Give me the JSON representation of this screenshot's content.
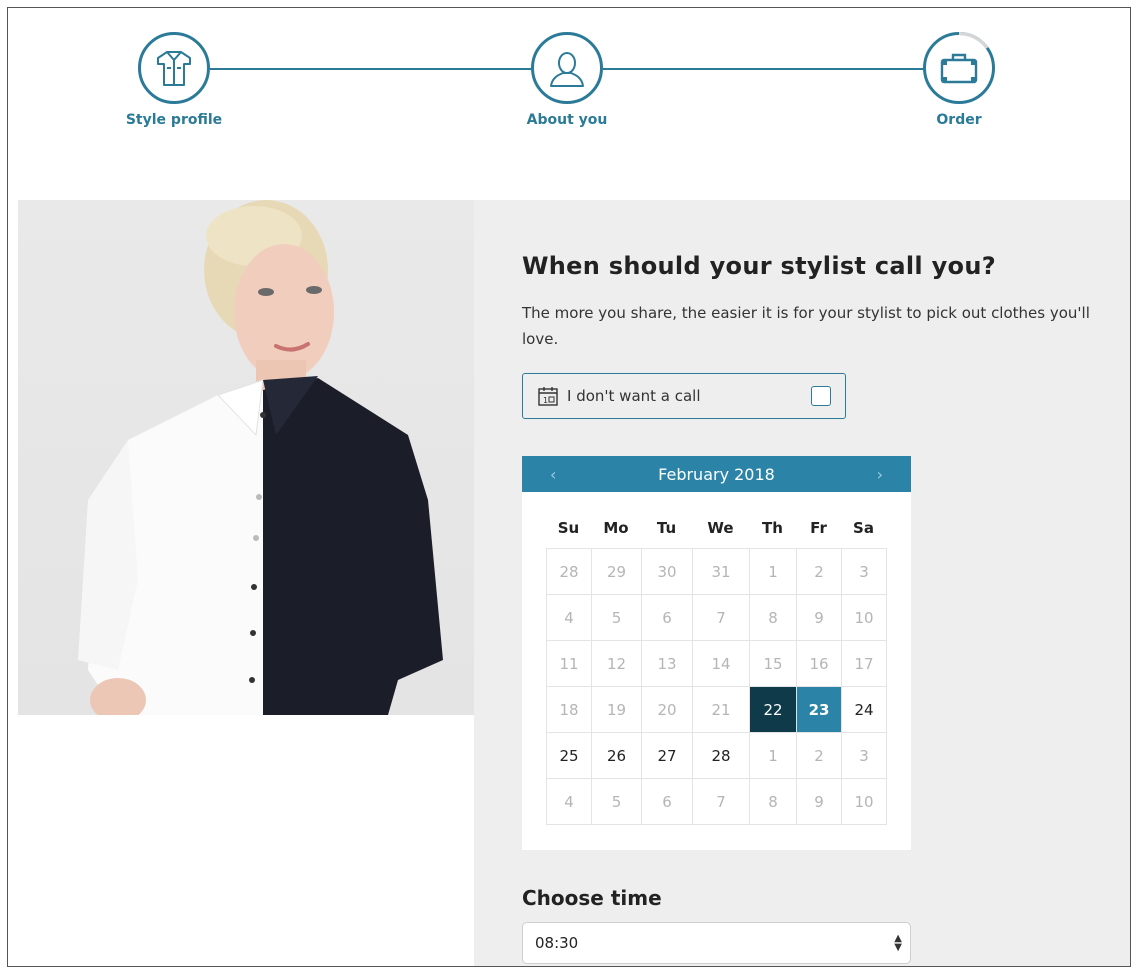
{
  "steps": [
    {
      "label": "Style profile",
      "icon": "shirt-icon"
    },
    {
      "label": "About you",
      "icon": "person-icon"
    },
    {
      "label": "Order",
      "icon": "suitcase-icon"
    }
  ],
  "call": {
    "heading": "When should your stylist call you?",
    "subtext": "The more you share, the easier it is for your stylist to pick out clothes you'll love.",
    "no_call_label": "I don't want a call"
  },
  "calendar": {
    "month": "February 2018",
    "prev": "‹",
    "next": "›",
    "dows": [
      "Su",
      "Mo",
      "Tu",
      "We",
      "Th",
      "Fr",
      "Sa"
    ],
    "weeks": [
      [
        {
          "d": "28",
          "s": "muted"
        },
        {
          "d": "29",
          "s": "muted"
        },
        {
          "d": "30",
          "s": "muted"
        },
        {
          "d": "31",
          "s": "muted"
        },
        {
          "d": "1",
          "s": "muted"
        },
        {
          "d": "2",
          "s": "muted"
        },
        {
          "d": "3",
          "s": "muted"
        }
      ],
      [
        {
          "d": "4",
          "s": "muted"
        },
        {
          "d": "5",
          "s": "muted"
        },
        {
          "d": "6",
          "s": "muted"
        },
        {
          "d": "7",
          "s": "muted"
        },
        {
          "d": "8",
          "s": "muted"
        },
        {
          "d": "9",
          "s": "muted"
        },
        {
          "d": "10",
          "s": "muted"
        }
      ],
      [
        {
          "d": "11",
          "s": "muted"
        },
        {
          "d": "12",
          "s": "muted"
        },
        {
          "d": "13",
          "s": "muted"
        },
        {
          "d": "14",
          "s": "muted"
        },
        {
          "d": "15",
          "s": "muted"
        },
        {
          "d": "16",
          "s": "muted"
        },
        {
          "d": "17",
          "s": "muted"
        }
      ],
      [
        {
          "d": "18",
          "s": "muted"
        },
        {
          "d": "19",
          "s": "muted"
        },
        {
          "d": "20",
          "s": "muted"
        },
        {
          "d": "21",
          "s": "muted"
        },
        {
          "d": "22",
          "s": "today"
        },
        {
          "d": "23",
          "s": "selected"
        },
        {
          "d": "24",
          "s": ""
        }
      ],
      [
        {
          "d": "25",
          "s": ""
        },
        {
          "d": "26",
          "s": ""
        },
        {
          "d": "27",
          "s": ""
        },
        {
          "d": "28",
          "s": ""
        },
        {
          "d": "1",
          "s": "muted"
        },
        {
          "d": "2",
          "s": "muted"
        },
        {
          "d": "3",
          "s": "muted"
        }
      ],
      [
        {
          "d": "4",
          "s": "muted"
        },
        {
          "d": "5",
          "s": "muted"
        },
        {
          "d": "6",
          "s": "muted"
        },
        {
          "d": "7",
          "s": "muted"
        },
        {
          "d": "8",
          "s": "muted"
        },
        {
          "d": "9",
          "s": "muted"
        },
        {
          "d": "10",
          "s": "muted"
        }
      ]
    ]
  },
  "time": {
    "heading": "Choose time",
    "value": "08:30"
  },
  "colors": {
    "accent": "#2b7a98",
    "calendar_header": "#2b84a8",
    "today": "#0f3a4a"
  }
}
